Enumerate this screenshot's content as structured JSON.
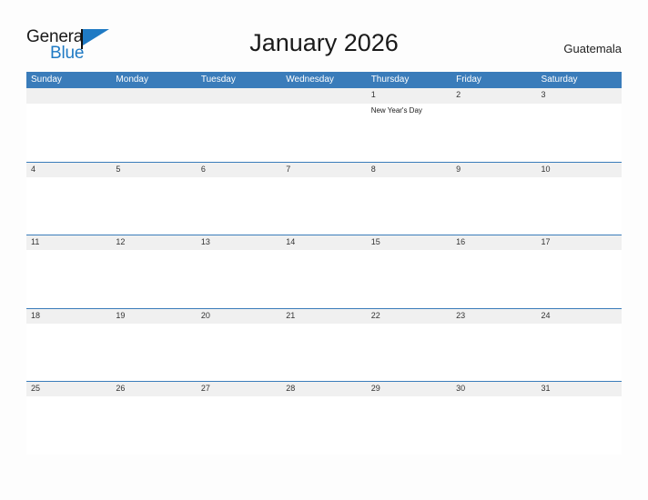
{
  "branding": {
    "logo_primary": "General",
    "logo_secondary": "Blue",
    "logo_icon": "flag-triangle-icon",
    "accent_color": "#1f7ac4"
  },
  "header": {
    "title": "January 2026",
    "country": "Guatemala"
  },
  "calendar": {
    "header_bg_color": "#3a7cba",
    "band_bg_color": "#f0f0f0",
    "weekdays": [
      "Sunday",
      "Monday",
      "Tuesday",
      "Wednesday",
      "Thursday",
      "Friday",
      "Saturday"
    ],
    "weeks": [
      {
        "days": [
          {
            "num": "",
            "event": ""
          },
          {
            "num": "",
            "event": ""
          },
          {
            "num": "",
            "event": ""
          },
          {
            "num": "",
            "event": ""
          },
          {
            "num": "1",
            "event": "New Year's Day"
          },
          {
            "num": "2",
            "event": ""
          },
          {
            "num": "3",
            "event": ""
          }
        ]
      },
      {
        "days": [
          {
            "num": "4",
            "event": ""
          },
          {
            "num": "5",
            "event": ""
          },
          {
            "num": "6",
            "event": ""
          },
          {
            "num": "7",
            "event": ""
          },
          {
            "num": "8",
            "event": ""
          },
          {
            "num": "9",
            "event": ""
          },
          {
            "num": "10",
            "event": ""
          }
        ]
      },
      {
        "days": [
          {
            "num": "11",
            "event": ""
          },
          {
            "num": "12",
            "event": ""
          },
          {
            "num": "13",
            "event": ""
          },
          {
            "num": "14",
            "event": ""
          },
          {
            "num": "15",
            "event": ""
          },
          {
            "num": "16",
            "event": ""
          },
          {
            "num": "17",
            "event": ""
          }
        ]
      },
      {
        "days": [
          {
            "num": "18",
            "event": ""
          },
          {
            "num": "19",
            "event": ""
          },
          {
            "num": "20",
            "event": ""
          },
          {
            "num": "21",
            "event": ""
          },
          {
            "num": "22",
            "event": ""
          },
          {
            "num": "23",
            "event": ""
          },
          {
            "num": "24",
            "event": ""
          }
        ]
      },
      {
        "days": [
          {
            "num": "25",
            "event": ""
          },
          {
            "num": "26",
            "event": ""
          },
          {
            "num": "27",
            "event": ""
          },
          {
            "num": "28",
            "event": ""
          },
          {
            "num": "29",
            "event": ""
          },
          {
            "num": "30",
            "event": ""
          },
          {
            "num": "31",
            "event": ""
          }
        ]
      }
    ]
  }
}
